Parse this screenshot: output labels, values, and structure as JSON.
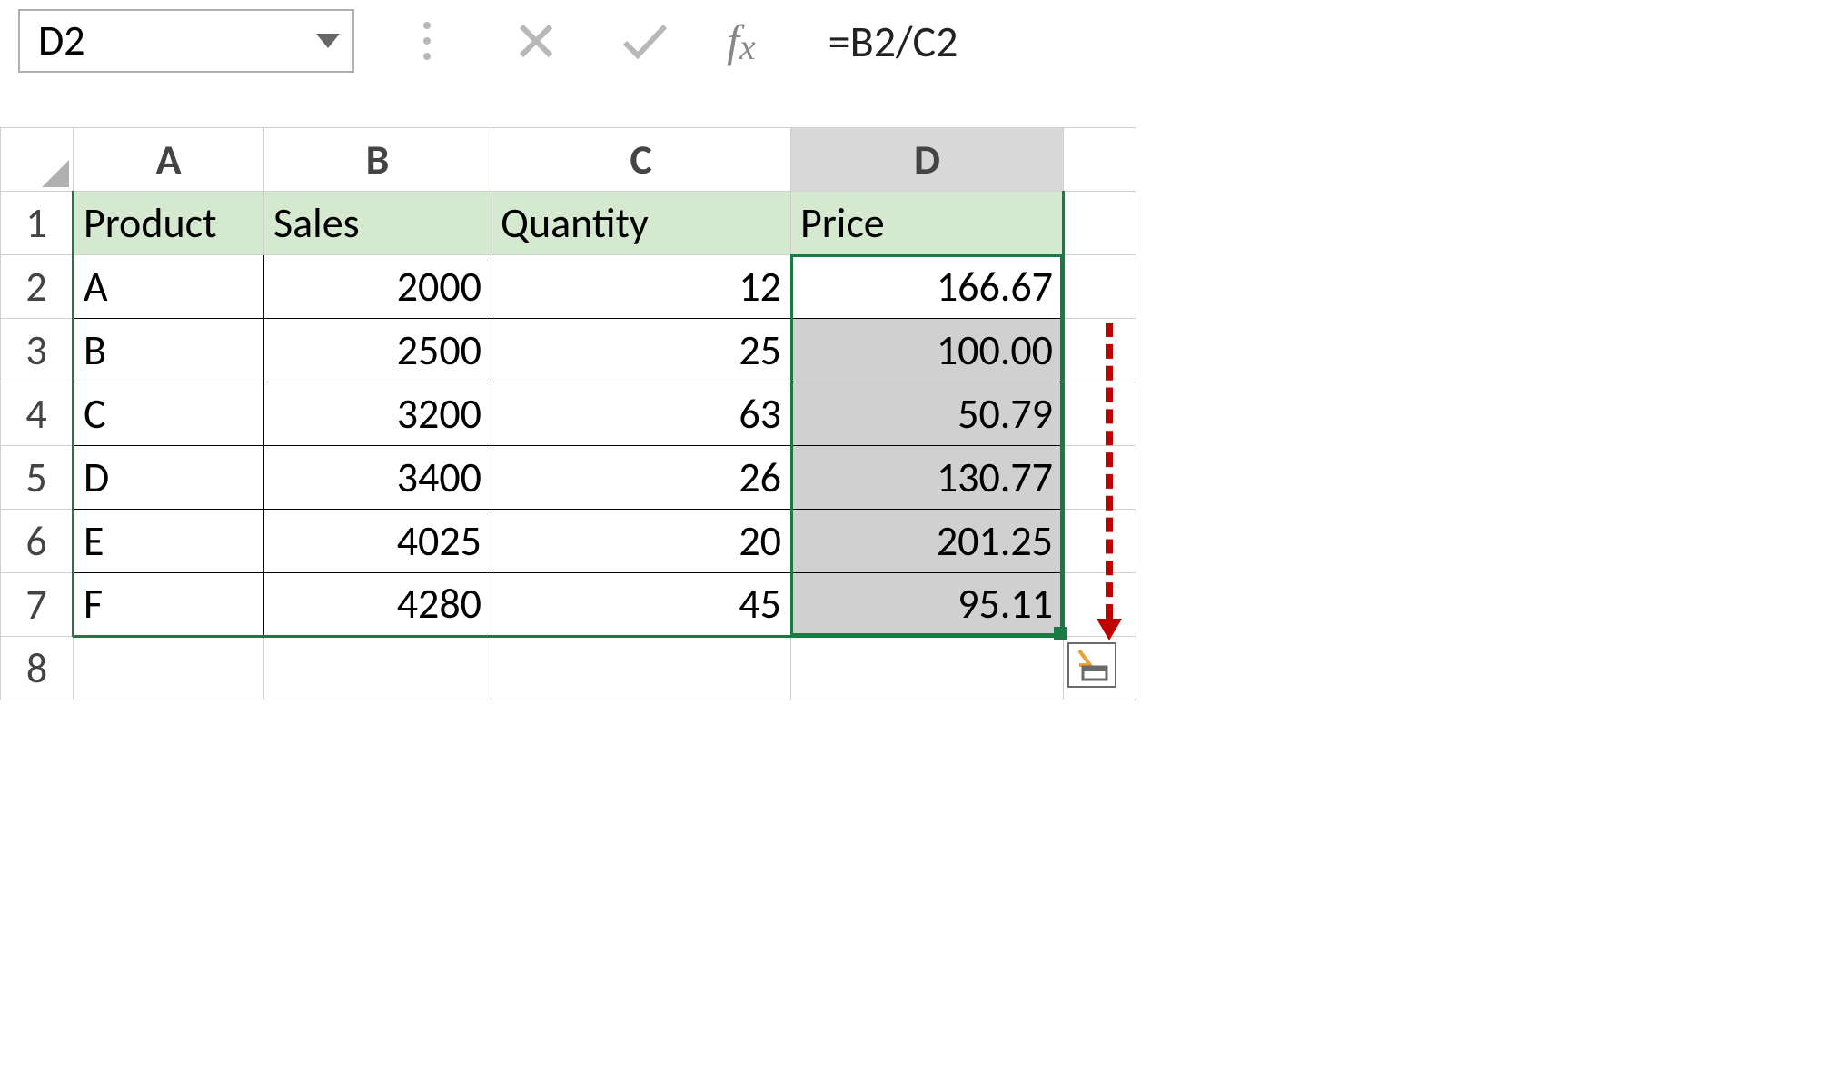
{
  "formula_bar": {
    "cell_ref": "D2",
    "fx_label": "fx",
    "formula": "=B2/C2"
  },
  "columns": [
    "A",
    "B",
    "C",
    "D"
  ],
  "row_numbers": [
    "1",
    "2",
    "3",
    "4",
    "5",
    "6",
    "7",
    "8"
  ],
  "headers": {
    "product": "Product",
    "sales": "Sales",
    "quantity": "Quantity",
    "price": "Price"
  },
  "rows": [
    {
      "product": "A",
      "sales": "2000",
      "quantity": "12",
      "price": "166.67"
    },
    {
      "product": "B",
      "sales": "2500",
      "quantity": "25",
      "price": "100.00"
    },
    {
      "product": "C",
      "sales": "3200",
      "quantity": "63",
      "price": "50.79"
    },
    {
      "product": "D",
      "sales": "3400",
      "quantity": "26",
      "price": "130.77"
    },
    {
      "product": "E",
      "sales": "4025",
      "quantity": "20",
      "price": "201.25"
    },
    {
      "product": "F",
      "sales": "4280",
      "quantity": "45",
      "price": "95.11"
    }
  ],
  "selected_column": "D",
  "active_cell": "D2"
}
